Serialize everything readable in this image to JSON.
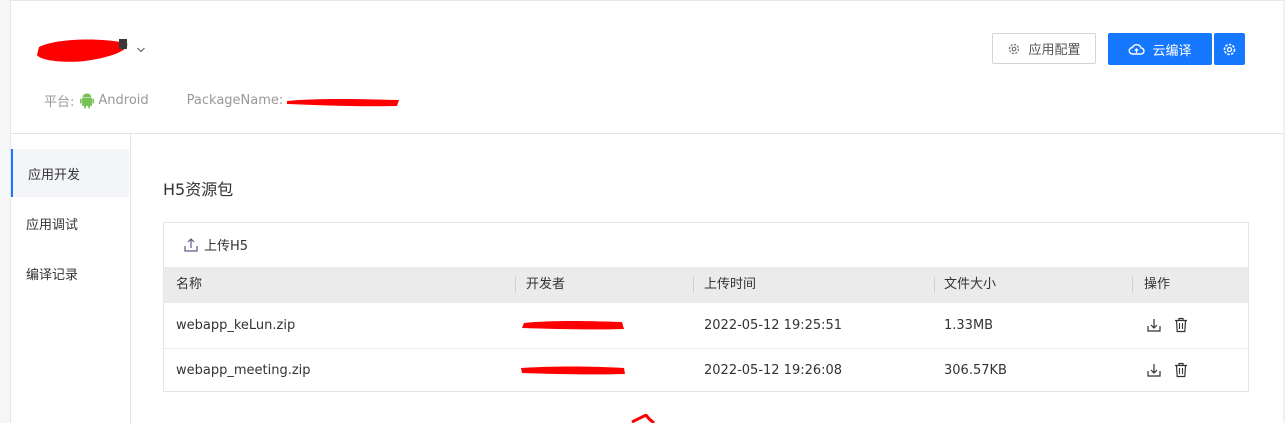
{
  "header": {
    "platform_label": "平台:",
    "platform_value": "Android",
    "package_label": "PackageName:",
    "config_button": "应用配置",
    "compile_button": "云编译"
  },
  "sidebar": {
    "items": [
      {
        "label": "应用开发",
        "active": true
      },
      {
        "label": "应用调试",
        "active": false
      },
      {
        "label": "编译记录",
        "active": false
      }
    ]
  },
  "main": {
    "section_title": "H5资源包",
    "upload_label": "上传H5",
    "columns": [
      "名称",
      "开发者",
      "上传时间",
      "文件大小",
      "操作"
    ],
    "rows": [
      {
        "name": "webapp_keLun.zip",
        "time": "2022-05-12 19:25:51",
        "size": "1.33MB"
      },
      {
        "name": "webapp_meeting.zip",
        "time": "2022-05-12 19:26:08",
        "size": "306.57KB"
      }
    ]
  },
  "colors": {
    "accent": "#1677ff",
    "redaction": "#ff0000",
    "android_green": "#78c257"
  },
  "icons": [
    "chevron-down-icon",
    "android-icon",
    "gear-icon",
    "cloud-icon",
    "upload-icon",
    "download-icon",
    "trash-icon"
  ]
}
